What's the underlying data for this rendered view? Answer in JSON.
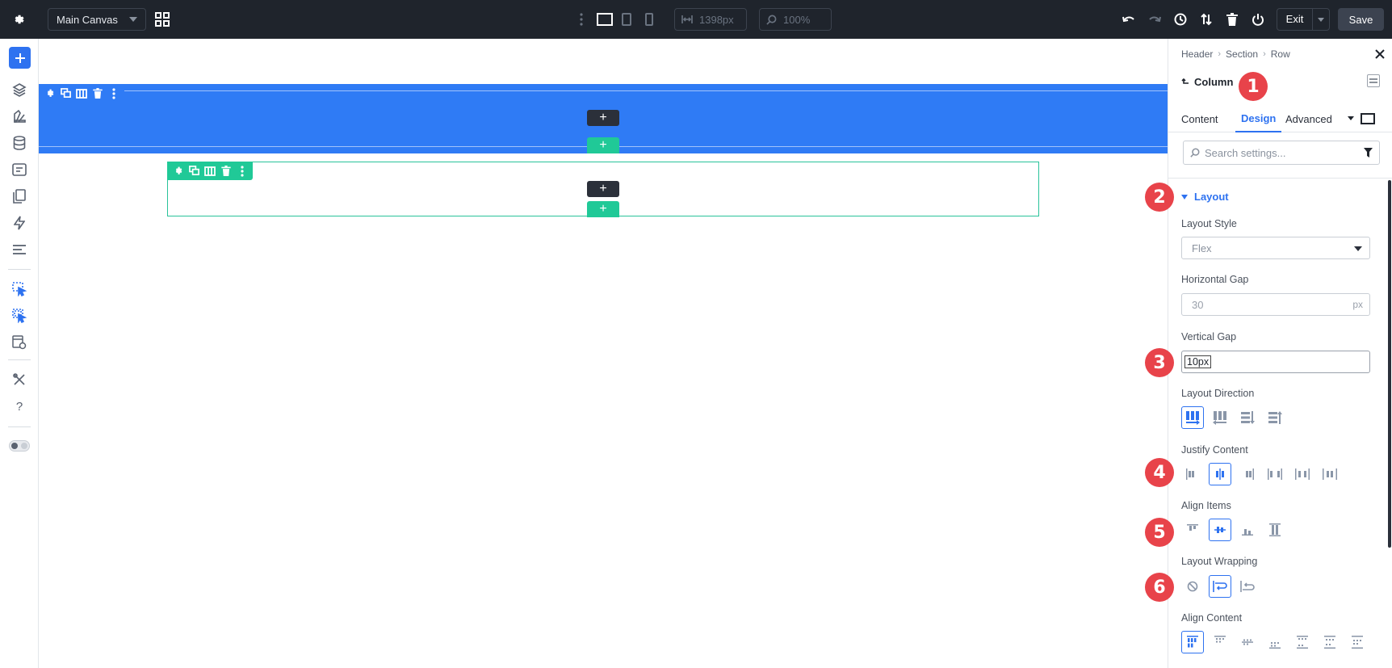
{
  "topbar": {
    "canvas_name": "Main Canvas",
    "width_value": "1398px",
    "zoom_value": "100%",
    "exit_label": "Exit",
    "save_label": "Save"
  },
  "panel": {
    "breadcrumbs": [
      "Header",
      "Section",
      "Row"
    ],
    "element_title": "Column",
    "tabs": [
      "Content",
      "Design",
      "Advanced"
    ],
    "active_tab": "Design",
    "search_placeholder": "Search settings...",
    "group_title": "Layout",
    "layout_style_label": "Layout Style",
    "layout_style_value": "Flex",
    "horizontal_gap_label": "Horizontal Gap",
    "horizontal_gap_placeholder": "30",
    "horizontal_gap_unit": "px",
    "vertical_gap_label": "Vertical Gap",
    "vertical_gap_value": "10px",
    "layout_direction_label": "Layout Direction",
    "justify_content_label": "Justify Content",
    "align_items_label": "Align Items",
    "layout_wrapping_label": "Layout Wrapping",
    "align_content_label": "Align Content"
  },
  "badges": [
    "1",
    "2",
    "3",
    "4",
    "5",
    "6"
  ],
  "canvas": {
    "add_symbol": "+"
  },
  "colors": {
    "accent": "#2e72f0",
    "section_blue": "#2f7bf5",
    "row_green": "#20c997",
    "badge_red": "#e8434a",
    "topbar": "#1f242c"
  }
}
